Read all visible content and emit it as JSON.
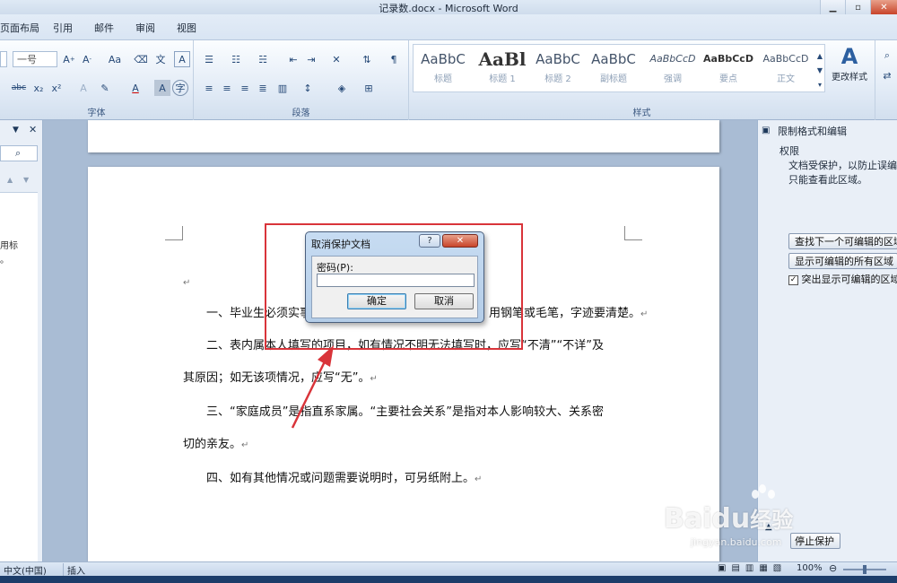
{
  "window": {
    "title": "记录数.docx - Microsoft Word",
    "minimize": "▁",
    "restore": "▫",
    "close": "✕"
  },
  "tabs": [
    "页面布局",
    "引用",
    "邮件",
    "审阅",
    "视图"
  ],
  "ribbon": {
    "font_group": {
      "label": "字体",
      "size_value": "一号"
    },
    "paragraph_group": {
      "label": "段落"
    },
    "styles_group": {
      "label": "样式",
      "styles": [
        {
          "preview": "AaBbC",
          "name": "标题"
        },
        {
          "preview": "AaBl",
          "name": "标题 1"
        },
        {
          "preview": "AaBbC",
          "name": "标题 2"
        },
        {
          "preview": "AaBbC",
          "name": "副标题"
        },
        {
          "preview": "AaBbCcD",
          "name": "强调"
        },
        {
          "preview": "AaBbCcD",
          "name": "要点"
        },
        {
          "preview": "AaBbCcD",
          "name": "正文"
        }
      ],
      "change_styles": "更改样式"
    }
  },
  "left_pane": {
    "partial_text_1": "用标",
    "partial_text_2": "。"
  },
  "document": {
    "para_mark": "↵",
    "paragraphs": [
      {
        "text": "一、毕业生必须实事求是地填写，用钢笔或毛笔，字迹要清楚。"
      },
      {
        "text": "二、表内属本人填写的项目，如有情况不明无法填写时，应写“不清”“不详”及"
      },
      {
        "text": "其原因；如无该项情况，应写“无”。"
      },
      {
        "text": "三、“家庭成员”是指直系家属。“主要社会关系”是指对本人影响较大、关系密"
      },
      {
        "text": "切的亲友。"
      },
      {
        "text": "四、如有其他情况或问题需要说明时，可另纸附上。"
      }
    ],
    "para1_visible_left": "一、毕业生必须实事",
    "para1_visible_right": "用钢笔或毛笔，字迹要清楚。"
  },
  "dialog": {
    "title": "取消保护文档",
    "help": "?",
    "close": "✕",
    "password_label": "密码(P):",
    "password_value": "",
    "ok": "确定",
    "cancel": "取消"
  },
  "right_pane": {
    "title": "限制格式和编辑",
    "section": "权限",
    "desc_line1": "文档受保护，以防止误编辑",
    "desc_line2": "只能查看此区域。",
    "find_next": "查找下一个可编辑的区域",
    "show_all": "显示可编辑的所有区域",
    "highlight": "突出显示可编辑的区域",
    "highlight_checked": true,
    "stop_protection": "停止保护"
  },
  "status": {
    "language": "中文(中国)",
    "mode": "插入",
    "zoom": "100%"
  },
  "watermark": {
    "brand": "Baidu",
    "jingyan": "经验",
    "url": "jingyan.baidu.com"
  },
  "colors": {
    "highlight_red": "#d9343a",
    "ribbon_blue": "#dfe9f5",
    "text_blue": "#1e395b"
  }
}
